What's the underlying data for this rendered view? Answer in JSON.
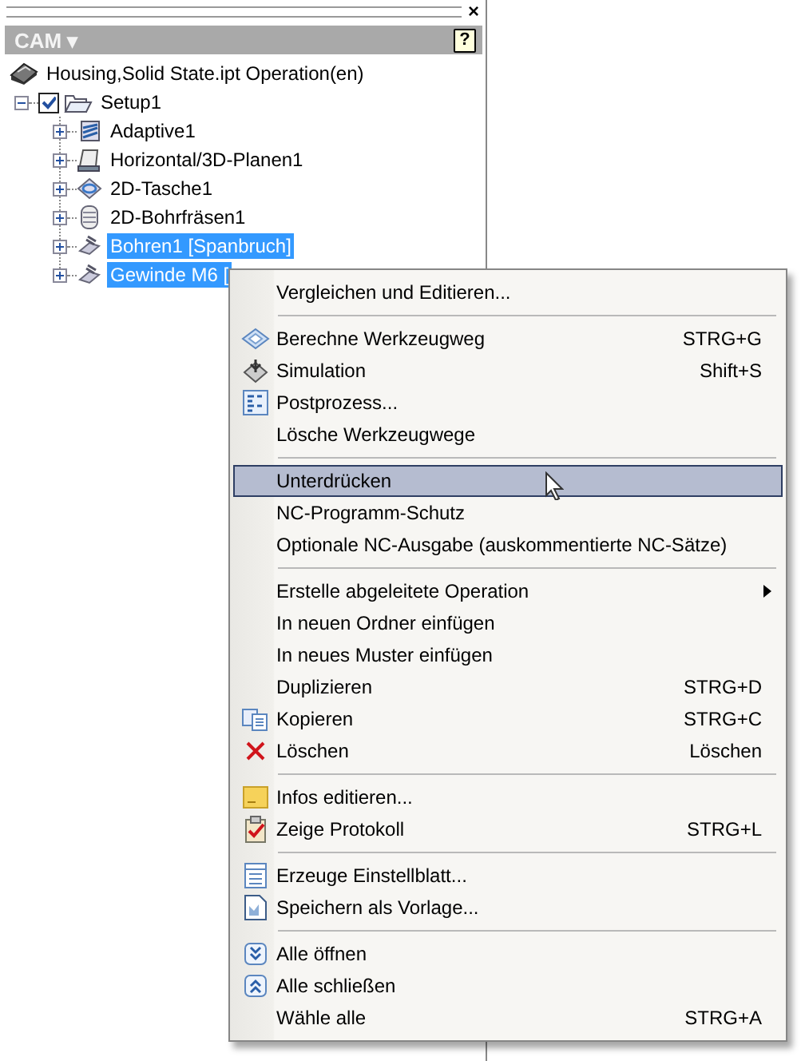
{
  "panel": {
    "close": "×",
    "title": "CAM ▾",
    "help": "?"
  },
  "tree": {
    "label": "Housing,Solid State.ipt Operation(en)",
    "children": [
      {
        "label": "Setup1",
        "expanded": true,
        "checked": true,
        "selected": false,
        "children": [
          {
            "label": "Adaptive1",
            "expanded": false,
            "selected": false
          },
          {
            "label": "Horizontal/3D-Planen1",
            "expanded": false,
            "selected": false
          },
          {
            "label": "2D-Tasche1",
            "expanded": false,
            "selected": false
          },
          {
            "label": "2D-Bohrfräsen1",
            "expanded": false,
            "selected": false
          },
          {
            "label": "Bohren1 [Spanbruch]",
            "expanded": false,
            "selected": true
          },
          {
            "label": "Gewinde M6 [",
            "expanded": false,
            "selected": true
          }
        ]
      }
    ]
  },
  "menu": [
    {
      "kind": "item",
      "label": "Vergleichen und Editieren...",
      "selected": false
    },
    {
      "kind": "separator"
    },
    {
      "kind": "item",
      "label": "Berechne Werkzeugweg",
      "shortcut": "STRG+G",
      "selected": false
    },
    {
      "kind": "item",
      "label": "Simulation",
      "shortcut": "Shift+S",
      "selected": false
    },
    {
      "kind": "item",
      "label": "Postprozess...",
      "selected": false
    },
    {
      "kind": "item",
      "label": "Lösche Werkzeugwege",
      "selected": false
    },
    {
      "kind": "separator"
    },
    {
      "kind": "item",
      "label": "Unterdrücken",
      "selected": true
    },
    {
      "kind": "item",
      "label": "NC-Programm-Schutz",
      "selected": false
    },
    {
      "kind": "item",
      "label": "Optionale NC-Ausgabe (auskommentierte NC-Sätze)",
      "selected": false
    },
    {
      "kind": "separator"
    },
    {
      "kind": "item",
      "label": "Erstelle abgeleitete Operation",
      "submenu": true,
      "selected": false
    },
    {
      "kind": "item",
      "label": "In neuen Ordner einfügen",
      "selected": false
    },
    {
      "kind": "item",
      "label": "In neues Muster einfügen",
      "selected": false
    },
    {
      "kind": "item",
      "label": "Duplizieren",
      "shortcut": "STRG+D",
      "selected": false
    },
    {
      "kind": "item",
      "label": "Kopieren",
      "shortcut": "STRG+C",
      "selected": false
    },
    {
      "kind": "item",
      "label": "Löschen",
      "shortcut": "Löschen",
      "selected": false
    },
    {
      "kind": "separator"
    },
    {
      "kind": "item",
      "label": "Infos editieren...",
      "selected": false
    },
    {
      "kind": "item",
      "label": "Zeige Protokoll",
      "shortcut": "STRG+L",
      "selected": false
    },
    {
      "kind": "separator"
    },
    {
      "kind": "item",
      "label": "Erzeuge Einstellblatt...",
      "selected": false
    },
    {
      "kind": "item",
      "label": "Speichern als Vorlage...",
      "selected": false
    },
    {
      "kind": "separator"
    },
    {
      "kind": "item",
      "label": "Alle öffnen",
      "selected": false
    },
    {
      "kind": "item",
      "label": "Alle schließen",
      "selected": false
    },
    {
      "kind": "item",
      "label": "Wähle alle",
      "shortcut": "STRG+A",
      "selected": false
    }
  ]
}
